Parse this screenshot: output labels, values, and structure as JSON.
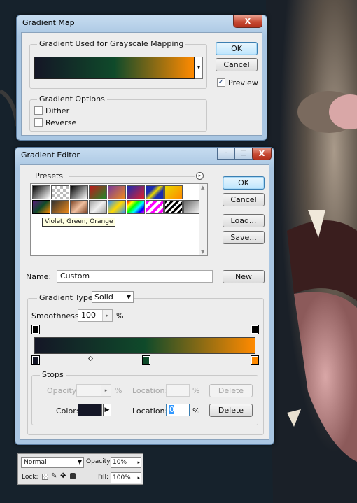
{
  "gradient_map": {
    "title": "Gradient Map",
    "close_label": "X",
    "group_gradient_label": "Gradient Used for Grayscale Mapping",
    "group_options_label": "Gradient Options",
    "dither_label": "Dither",
    "reverse_label": "Reverse",
    "ok_label": "OK",
    "cancel_label": "Cancel",
    "preview_label": "Preview",
    "preview_checked": "✓",
    "dropdown_arrow": "▾"
  },
  "gradient_editor": {
    "title": "Gradient Editor",
    "minimize_label": "–",
    "maximize_label": "□",
    "close_label": "X",
    "presets_label": "Presets",
    "presets_menu_icon": "▸",
    "tooltip": "Violet, Green, Orange",
    "ok_label": "OK",
    "cancel_label": "Cancel",
    "load_label": "Load...",
    "save_label": "Save...",
    "name_label": "Name:",
    "name_value": "Custom",
    "new_label": "New",
    "gradient_type_label": "Gradient Type:",
    "gradient_type_value": "Solid",
    "smoothness_label": "Smoothness:",
    "smoothness_value": "100",
    "percent": "%",
    "stops_label": "Stops",
    "opacity_label": "Opacity:",
    "location_label": "Location:",
    "delete_label": "Delete",
    "color_label": "Color:",
    "location_value": "0",
    "scroll_up": "▲",
    "scroll_down": "▼",
    "colors": {
      "start": "#141626",
      "mid": "#0f4a2a",
      "end": "#ff8a00"
    },
    "preset_swatches": [
      [
        "#000000-#ffffff",
        "#999999-checker",
        "#000000-#ffffff",
        "#c0181c-#1c8a2a",
        "#7a3b9a-#f08b1b",
        "#1a2cb0-#e0202a",
        "#1a2cb0-#e8d800",
        "#e8d800-#ff8a00"
      ],
      [
        "#5a1b7a-#0f4a2a-#ff8a00",
        "#303030-#f08b1b",
        "#7a4020-#f0c0a0",
        "#c0c0c0-#f0f0f0",
        "#3090ff-#ffd800",
        "#ff0000-#00ff00-#0000ff",
        "#ff00ff-#ffffff",
        "#000000-#ffffff stripes",
        "#000000-#ffffff stripes",
        "#666666-#ffffff"
      ]
    ]
  },
  "layers_panel": {
    "blend_mode": "Normal",
    "opacity_label": "Opacity:",
    "opacity_value": "10%",
    "lock_label": "Lock:",
    "fill_label": "Fill:",
    "fill_value": "100%"
  }
}
